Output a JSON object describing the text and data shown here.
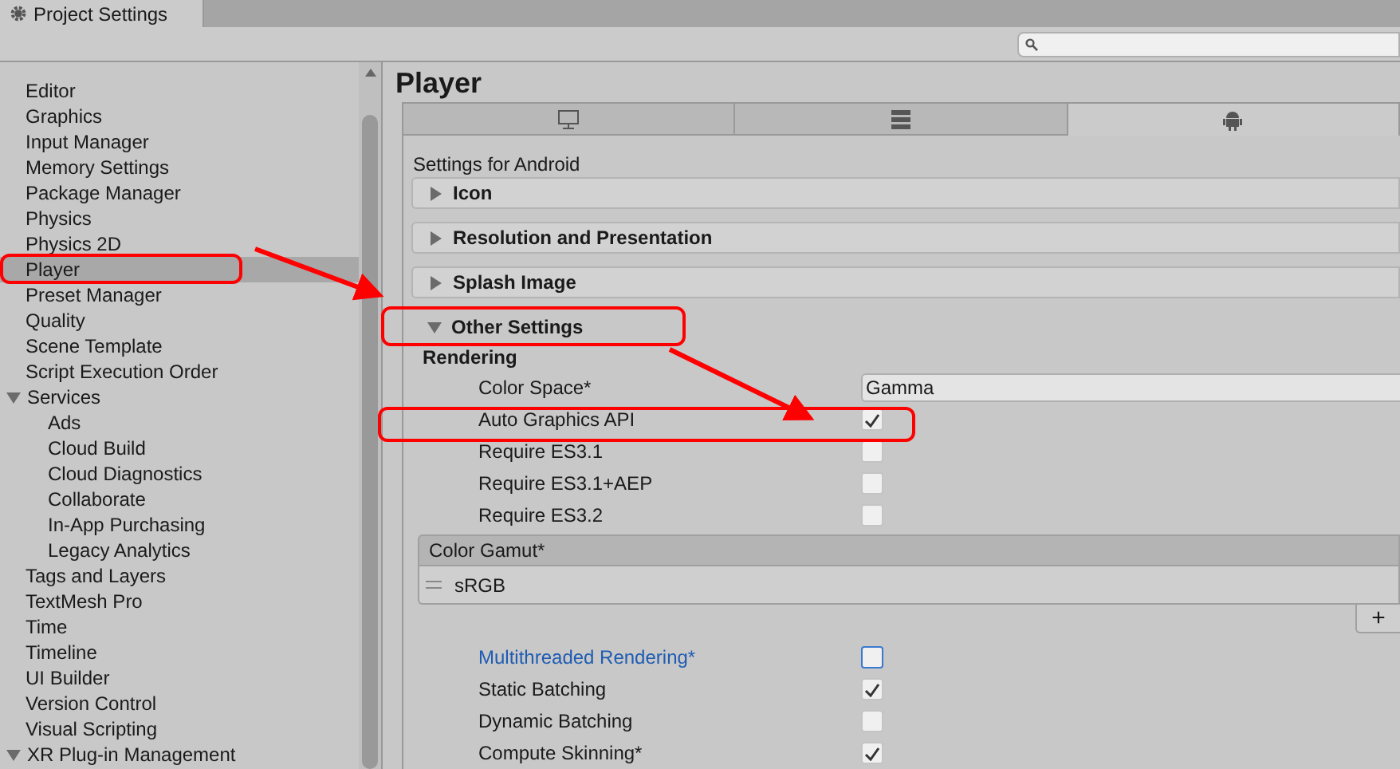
{
  "window": {
    "title": "Project Settings"
  },
  "sidebar": {
    "items": [
      {
        "label": "Editor",
        "selected": false
      },
      {
        "label": "Graphics",
        "selected": false
      },
      {
        "label": "Input Manager",
        "selected": false
      },
      {
        "label": "Memory Settings",
        "selected": false
      },
      {
        "label": "Package Manager",
        "selected": false
      },
      {
        "label": "Physics",
        "selected": false
      },
      {
        "label": "Physics 2D",
        "selected": false
      },
      {
        "label": "Player",
        "selected": true
      },
      {
        "label": "Preset Manager",
        "selected": false
      },
      {
        "label": "Quality",
        "selected": false
      },
      {
        "label": "Scene Template",
        "selected": false
      },
      {
        "label": "Script Execution Order",
        "selected": false
      },
      {
        "label": "Services",
        "selected": false,
        "expanded": true,
        "children": [
          {
            "label": "Ads",
            "selected": false
          },
          {
            "label": "Cloud Build",
            "selected": false
          },
          {
            "label": "Cloud Diagnostics",
            "selected": false
          },
          {
            "label": "Collaborate",
            "selected": false
          },
          {
            "label": "In-App Purchasing",
            "selected": false
          },
          {
            "label": "Legacy Analytics",
            "selected": false
          }
        ]
      },
      {
        "label": "Tags and Layers",
        "selected": false
      },
      {
        "label": "TextMesh Pro",
        "selected": false
      },
      {
        "label": "Time",
        "selected": false
      },
      {
        "label": "Timeline",
        "selected": false
      },
      {
        "label": "UI Builder",
        "selected": false
      },
      {
        "label": "Version Control",
        "selected": false
      },
      {
        "label": "Visual Scripting",
        "selected": false
      },
      {
        "label": "XR Plug-in Management",
        "selected": false,
        "expanded": true
      }
    ]
  },
  "page_title": "Player",
  "platform_tabs": [
    {
      "kind": "desktop",
      "selected": false
    },
    {
      "kind": "server",
      "selected": false
    },
    {
      "kind": "android",
      "selected": true
    }
  ],
  "settings_caption": "Settings for Android",
  "sections": [
    {
      "title": "Icon",
      "expanded": false
    },
    {
      "title": "Resolution and Presentation",
      "expanded": false
    },
    {
      "title": "Splash Image",
      "expanded": false
    },
    {
      "title": "Other Settings",
      "expanded": true
    }
  ],
  "other_settings": {
    "group": "Rendering",
    "rows": [
      {
        "kind": "dropdown",
        "label": "Color Space*",
        "value": "Gamma"
      },
      {
        "kind": "checkbox",
        "label": "Auto Graphics API",
        "checked": true
      },
      {
        "kind": "checkbox",
        "label": "Require ES3.1",
        "checked": false
      },
      {
        "kind": "checkbox",
        "label": "Require ES3.1+AEP",
        "checked": false
      },
      {
        "kind": "checkbox",
        "label": "Require ES3.2",
        "checked": false
      }
    ],
    "color_gamut": {
      "header": "Color Gamut*",
      "items": [
        "sRGB"
      ],
      "add_button": "+"
    },
    "rows_after": [
      {
        "kind": "checkbox",
        "label": "Multithreaded Rendering*",
        "checked": false,
        "focused": true
      },
      {
        "kind": "checkbox",
        "label": "Static Batching",
        "checked": true,
        "focused": false
      },
      {
        "kind": "checkbox",
        "label": "Dynamic Batching",
        "checked": false,
        "focused": false
      },
      {
        "kind": "checkbox",
        "label": "Compute Skinning*",
        "checked": true,
        "focused": false
      }
    ]
  },
  "annotations": [
    {
      "kind": "box"
    },
    {
      "kind": "box"
    },
    {
      "kind": "box"
    },
    {
      "kind": "arrow"
    },
    {
      "kind": "arrow"
    }
  ]
}
